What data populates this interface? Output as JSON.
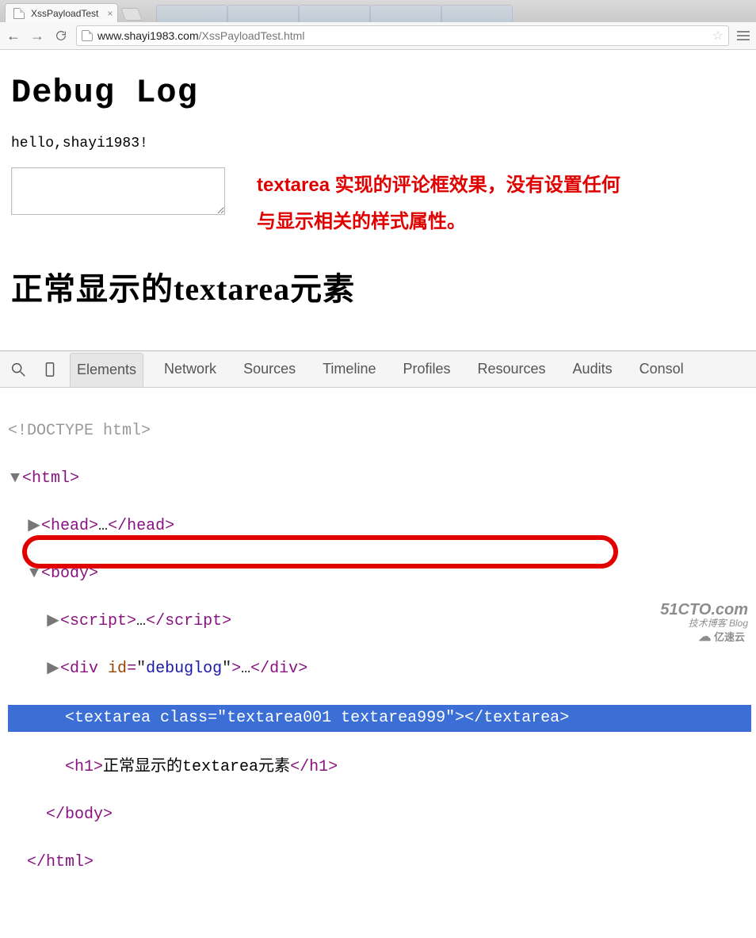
{
  "browser": {
    "tab_title": "XssPayloadTest",
    "url_host": "www.shayi1983.com",
    "url_path": "/XssPayloadTest.html"
  },
  "page": {
    "heading": "Debug Log",
    "hello_text": "hello,shayi1983!",
    "red_note_line1": "textarea 实现的评论框效果，没有设置任何",
    "red_note_line2": "与显示相关的样式属性。",
    "normal_heading": "正常显示的textarea元素"
  },
  "devtools": {
    "tabs": [
      "Elements",
      "Network",
      "Sources",
      "Timeline",
      "Profiles",
      "Resources",
      "Audits",
      "Consol"
    ],
    "active_tab_index": 0,
    "dom": {
      "doctype": "<!DOCTYPE html>",
      "html_open": "html",
      "head_open": "head",
      "head_ellipsis": "…",
      "body_open": "body",
      "script_open": "script",
      "script_ellipsis": "…",
      "div_open": "div",
      "div_attr_name": "id",
      "div_attr_val": "debuglog",
      "div_ellipsis": "…",
      "textarea_open": "textarea",
      "textarea_attr_name": "class",
      "textarea_attr_val": "textarea001 textarea999",
      "h1_open": "h1",
      "h1_text": "正常显示的textarea元素"
    }
  },
  "watermark": {
    "line1": "51CTO.com",
    "line2": "技术博客  Blog",
    "line3": "亿速云"
  }
}
